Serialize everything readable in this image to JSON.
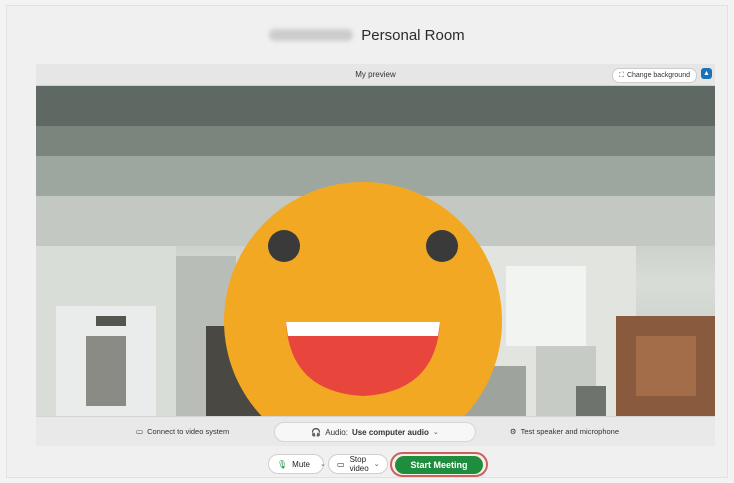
{
  "header": {
    "name_hidden": "",
    "room_title": "Personal Room"
  },
  "preview": {
    "label": "My preview",
    "change_background_label": "Change background"
  },
  "controls": {
    "connect_video_label": "Connect to video system",
    "audio_prefix": "Audio:",
    "audio_value": "Use computer audio",
    "test_label": "Test speaker and microphone"
  },
  "buttons": {
    "mute_label": "Mute",
    "stop_video_label": "Stop video",
    "start_meeting_label": "Start Meeting"
  },
  "colors": {
    "start_button": "#1e8e3e",
    "emoji_face": "#f2a823",
    "emoji_mouth": "#e8453c",
    "accent_blue": "#1a73b8"
  }
}
